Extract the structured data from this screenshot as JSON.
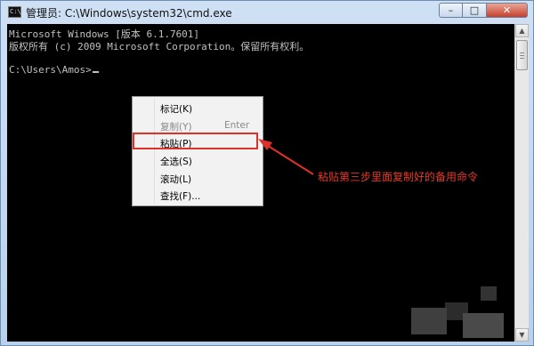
{
  "window": {
    "icon_text": "C:\\",
    "title": "管理员: C:\\Windows\\system32\\cmd.exe",
    "controls": {
      "minimize": "–",
      "maximize": "□",
      "close": "✕"
    }
  },
  "console": {
    "lines": [
      "Microsoft Windows [版本 6.1.7601]",
      "版权所有 (c) 2009 Microsoft Corporation。保留所有权利。",
      "",
      "C:\\Users\\Amos>"
    ]
  },
  "context_menu": {
    "items": [
      {
        "label": "标记(K)",
        "shortcut": "",
        "disabled": false
      },
      {
        "label": "复制(Y)",
        "shortcut": "Enter",
        "disabled": true
      },
      {
        "label": "粘贴(P)",
        "shortcut": "",
        "disabled": false
      },
      {
        "label": "全选(S)",
        "shortcut": "",
        "disabled": false
      },
      {
        "label": "滚动(L)",
        "shortcut": "",
        "disabled": false
      },
      {
        "label": "查找(F)...",
        "shortcut": "",
        "disabled": false
      }
    ]
  },
  "annotation": {
    "text": "粘贴第三步里面复制好的备用命令",
    "color": "#e53a2a"
  },
  "scrollbar": {
    "up_icon": "up-arrow-icon",
    "down_icon": "down-arrow-icon"
  }
}
